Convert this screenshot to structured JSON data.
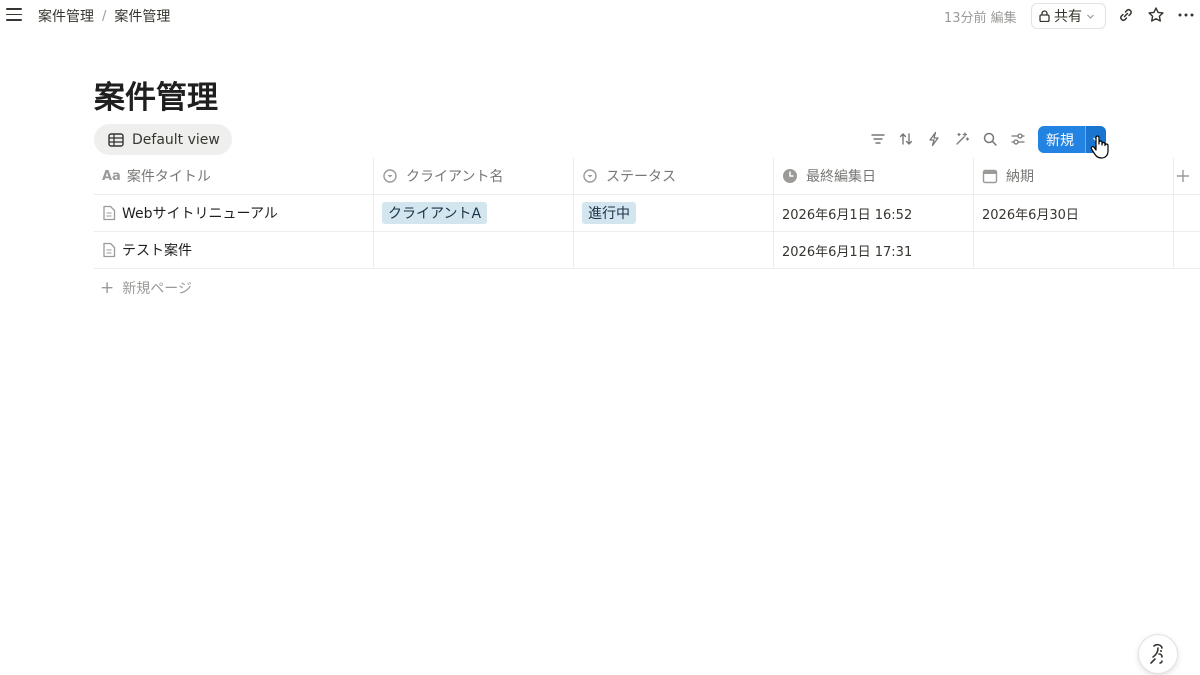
{
  "breadcrumb": [
    "案件管理",
    "案件管理"
  ],
  "breadcrumb_sep": "/",
  "topbar": {
    "edited": "13分前 編集",
    "share_label": "共有"
  },
  "page": {
    "title": "案件管理"
  },
  "view": {
    "tab_label": "Default view",
    "new_button_label": "新規"
  },
  "table": {
    "columns": [
      "案件タイトル",
      "クライアント名",
      "ステータス",
      "最終編集日",
      "納期"
    ],
    "title_icon_text": "Aa",
    "rows": [
      {
        "title": "Webサイトリニューアル",
        "client": "クライアントA",
        "status": "進行中",
        "last_edited": "2026年6月1日 16:52",
        "due": "2026年6月30日"
      },
      {
        "title": "テスト案件",
        "client": "",
        "status": "",
        "last_edited": "2026年6月1日 17:31",
        "due": ""
      }
    ],
    "new_page_label": "新規ページ"
  },
  "colors": {
    "accent": "#2383e2",
    "tag_bg": "#d3e5ef",
    "text": "#37352f",
    "muted": "#9b9a97"
  }
}
